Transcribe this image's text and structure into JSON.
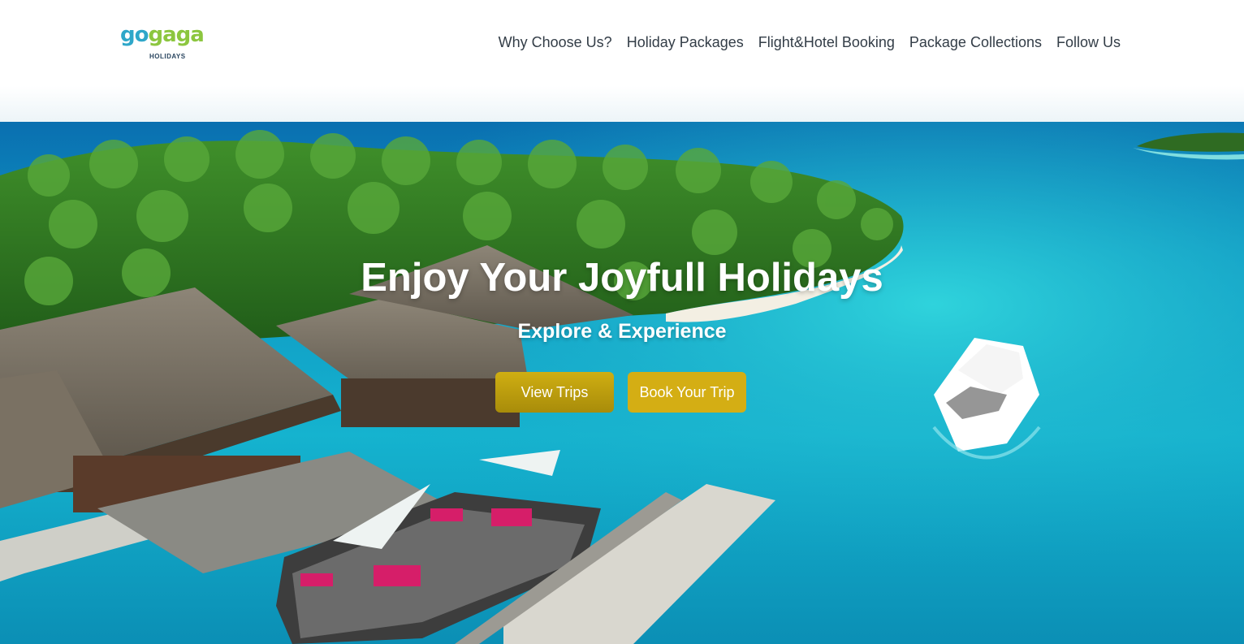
{
  "brand": {
    "logo_text_a": "go",
    "logo_text_b": "gaga",
    "logo_subtext": "HOLIDAYS"
  },
  "nav": {
    "items": [
      {
        "label": "Why Choose Us?"
      },
      {
        "label": "Holiday Packages"
      },
      {
        "label": "Flight&Hotel Booking"
      },
      {
        "label": "Package Collections"
      },
      {
        "label": "Follow Us"
      }
    ]
  },
  "hero": {
    "title": "Enjoy Your Joyfull Holidays",
    "subtitle": "Explore & Experience",
    "buttons": {
      "view_trips": "View Trips",
      "book_trip": "Book Your Trip"
    }
  },
  "colors": {
    "accent_gold": "#d4ae14",
    "logo_blue": "#2fa7c9",
    "logo_green": "#8cc63f",
    "nav_text": "#333d47"
  }
}
